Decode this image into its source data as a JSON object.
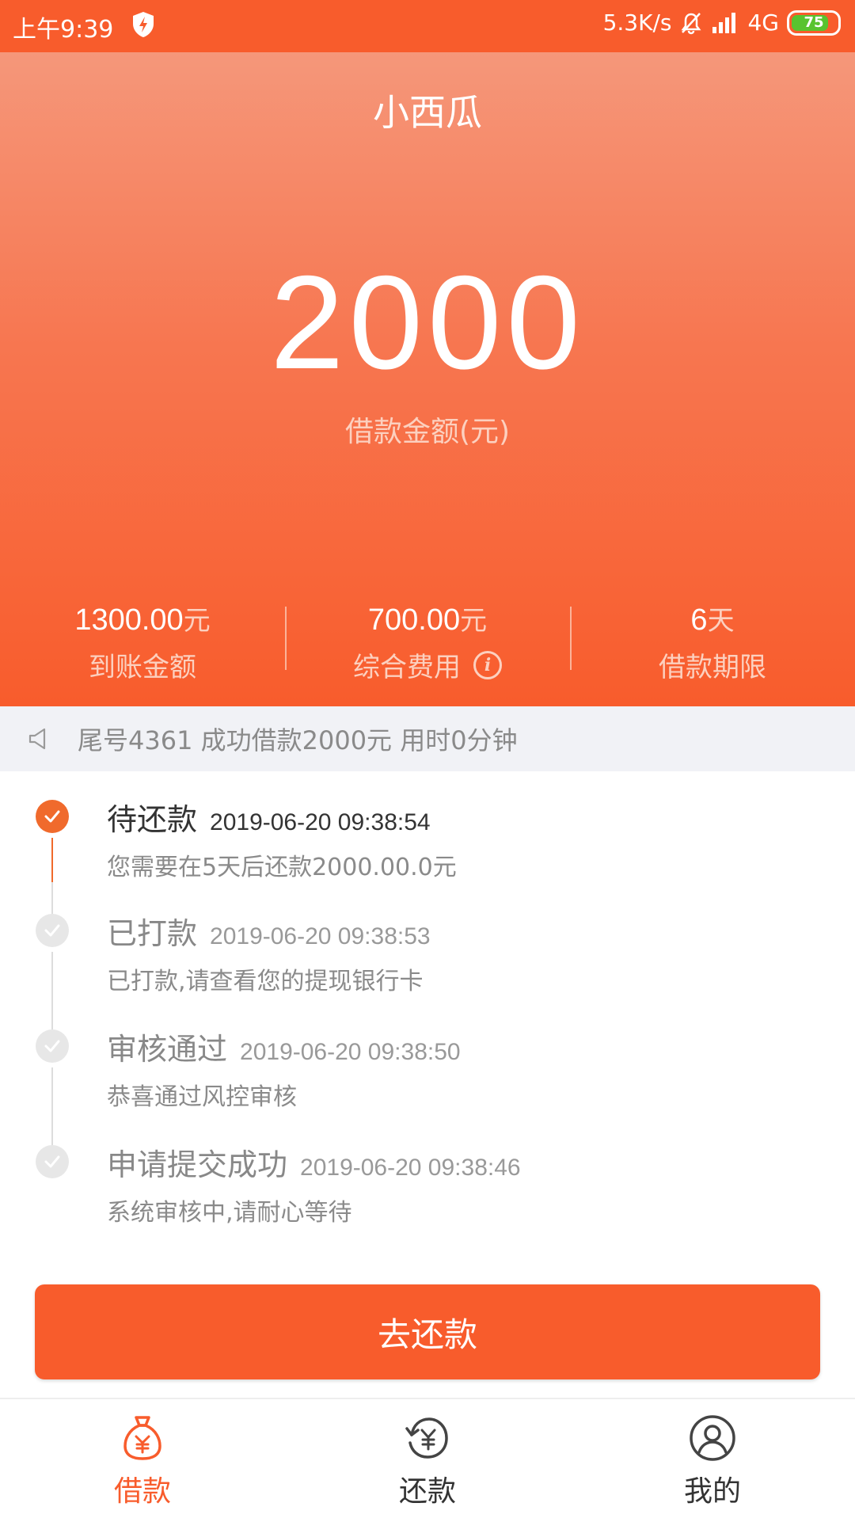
{
  "status_bar": {
    "time": "上午9:39",
    "network_speed": "5.3K/s",
    "network_type": "4G",
    "battery": "75"
  },
  "header": {
    "title": "小西瓜",
    "amount": "2000",
    "amount_label": "借款金额(元)"
  },
  "stats": [
    {
      "value": "1300.00",
      "unit": "元",
      "label": "到账金额"
    },
    {
      "value": "700.00",
      "unit": "元",
      "label": "综合费用"
    },
    {
      "value": "6",
      "unit": "天",
      "label": "借款期限"
    }
  ],
  "notice": {
    "text": "尾号4361 成功借款2000元 用时0分钟"
  },
  "timeline": [
    {
      "title": "待还款",
      "time": "2019-06-20 09:38:54",
      "desc": "您需要在5天后还款2000.00.0元",
      "active": true
    },
    {
      "title": "已打款",
      "time": "2019-06-20 09:38:53",
      "desc": "已打款,请查看您的提现银行卡",
      "active": false
    },
    {
      "title": "审核通过",
      "time": "2019-06-20 09:38:50",
      "desc": "恭喜通过风控审核",
      "active": false
    },
    {
      "title": "申请提交成功",
      "time": "2019-06-20 09:38:46",
      "desc": "系统审核中,请耐心等待",
      "active": false
    }
  ],
  "repay_button": "去还款",
  "bottom_nav": [
    {
      "label": "借款",
      "icon": "money-bag-icon",
      "active": true
    },
    {
      "label": "还款",
      "icon": "repay-cycle-icon",
      "active": false
    },
    {
      "label": "我的",
      "icon": "user-icon",
      "active": false
    }
  ],
  "colors": {
    "accent": "#f85c2c",
    "timeline_active": "#f06a2c",
    "notice_bg": "#f1f2f6"
  }
}
